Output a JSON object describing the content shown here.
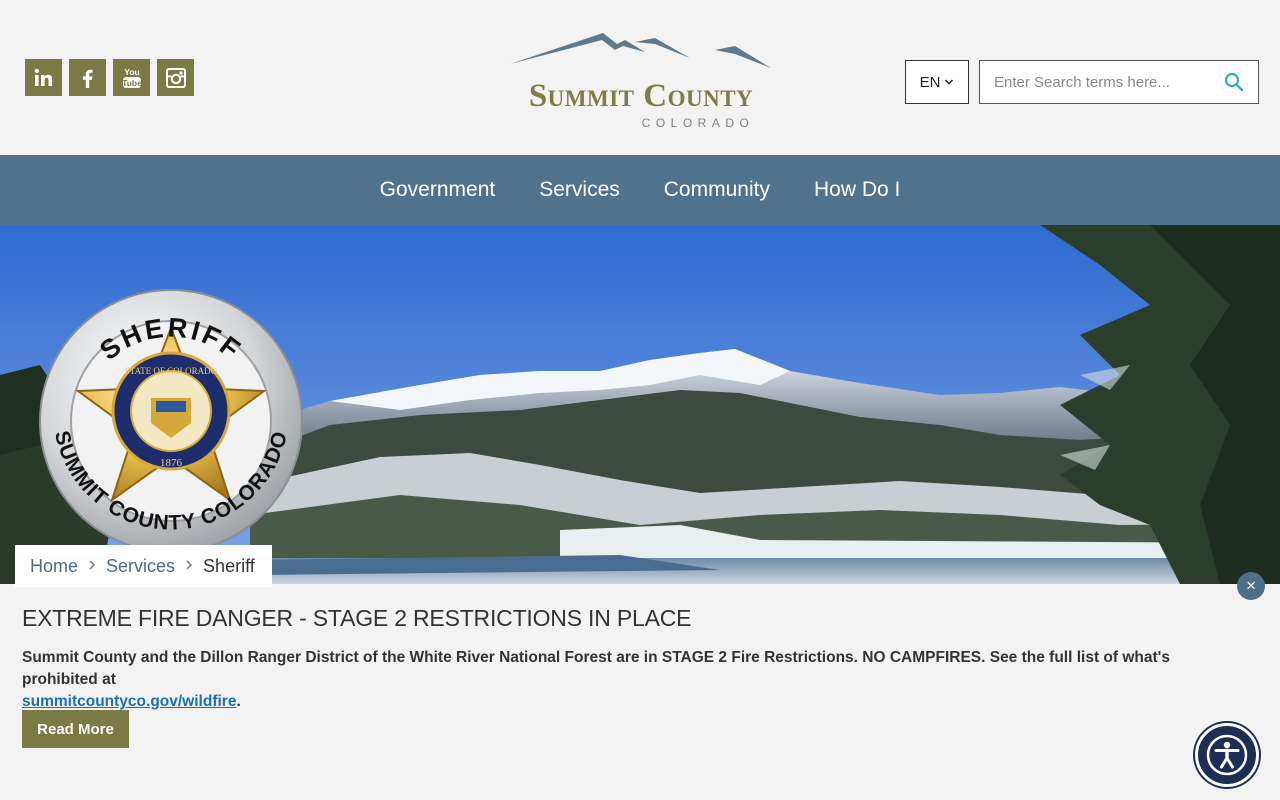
{
  "header": {
    "social": [
      {
        "name": "linkedin-icon",
        "label": "in"
      },
      {
        "name": "facebook-icon",
        "label": "f"
      },
      {
        "name": "youtube-icon",
        "label": "You Tube"
      },
      {
        "name": "instagram-icon",
        "label": ""
      }
    ],
    "logo": {
      "title": "Summit County",
      "subtitle": "COLORADO"
    },
    "language": {
      "value": "EN"
    },
    "search": {
      "placeholder": "Enter Search terms here..."
    }
  },
  "nav": {
    "items": [
      "Government",
      "Services",
      "Community",
      "How Do I"
    ]
  },
  "hero": {
    "badge": {
      "top": "SHERIFF",
      "bottom": "SUMMIT COUNTY COLORADO",
      "seal_text": "STATE OF COLORADO",
      "year": "1876"
    }
  },
  "breadcrumb": {
    "items": [
      "Home",
      "Services",
      "Sheriff"
    ]
  },
  "alert": {
    "close_label": "×",
    "title": "EXTREME FIRE DANGER - STAGE 2 RESTRICTIONS IN PLACE",
    "body": "Summit County and the Dillon Ranger District of the White River National Forest are in STAGE 2 Fire Restrictions. NO CAMPFIRES. See the full list of what's prohibited at",
    "link": "summitcountyco.gov/wildfire",
    "body_end": ".",
    "button": "Read More"
  },
  "colors": {
    "accent_olive": "#7b7a44",
    "nav_blue": "#50728d",
    "link_blue": "#1a6fb5",
    "accessibility_navy": "#1c2e54"
  }
}
